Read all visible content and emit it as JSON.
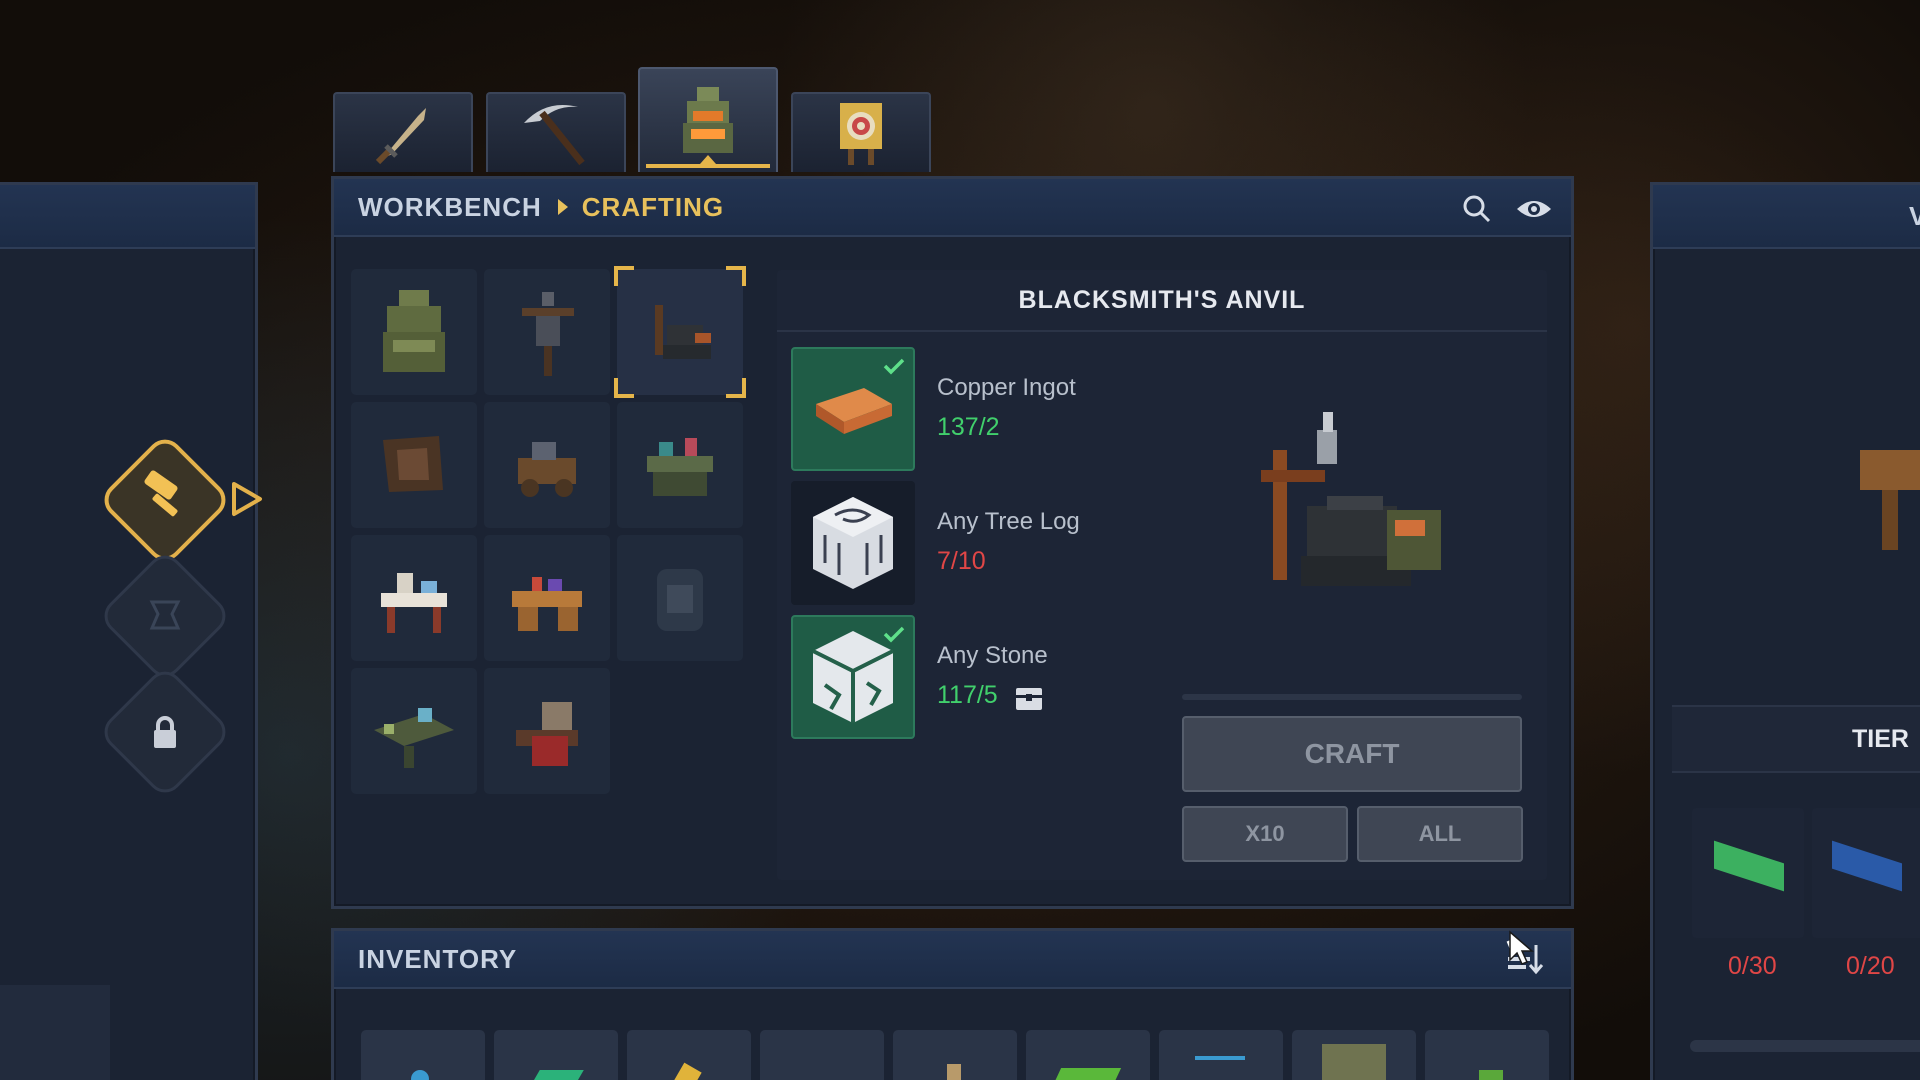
{
  "tabs": [
    {
      "icon": "sword-icon",
      "active": false
    },
    {
      "icon": "pickaxe-icon",
      "active": false
    },
    {
      "icon": "workbench-icon",
      "active": true
    },
    {
      "icon": "target-icon",
      "active": false
    }
  ],
  "breadcrumb": {
    "root": "WORKBENCH",
    "current": "CRAFTING"
  },
  "recipe_grid": [
    "workbench",
    "scarecrow-stand",
    "blacksmiths-anvil",
    "tanning-rack",
    "wood-cart",
    "alchemy-table",
    "tailor-table",
    "carpenter-desk",
    "furnace",
    "scribe-table",
    "loom"
  ],
  "selected_recipe": "BLACKSMITH'S ANVIL",
  "ingredients": [
    {
      "name": "Copper Ingot",
      "count": "137/2",
      "status": "ok",
      "icon": "copper-ingot-icon"
    },
    {
      "name": "Any Tree Log",
      "count": "7/10",
      "status": "missing",
      "icon": "tree-log-icon"
    },
    {
      "name": "Any Stone",
      "count": "117/5",
      "status": "ok",
      "icon": "stone-icon"
    }
  ],
  "actions": {
    "craft": "CRAFT",
    "x10": "X10",
    "all": "ALL"
  },
  "inventory": {
    "title": "INVENTORY"
  },
  "right_panel": {
    "tier_label": "TIER",
    "header_letter": "V",
    "counts": [
      "0/30",
      "0/20"
    ]
  },
  "colors": {
    "accent": "#e5b54a",
    "ok": "#41d06c",
    "missing": "#e04646",
    "header_bg": "#1c2b45"
  }
}
